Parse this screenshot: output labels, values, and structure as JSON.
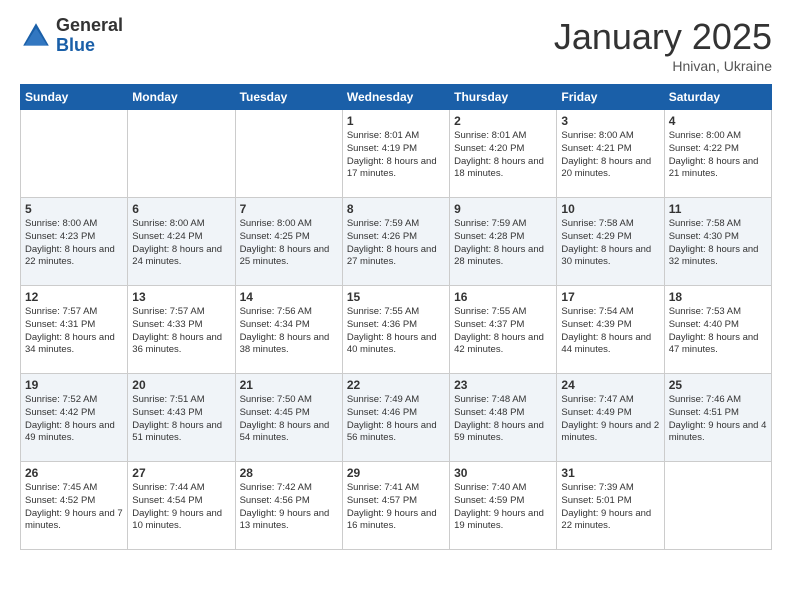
{
  "header": {
    "logo_general": "General",
    "logo_blue": "Blue",
    "month_title": "January 2025",
    "location": "Hnivan, Ukraine"
  },
  "weekdays": [
    "Sunday",
    "Monday",
    "Tuesday",
    "Wednesday",
    "Thursday",
    "Friday",
    "Saturday"
  ],
  "weeks": [
    [
      {
        "day": "",
        "info": ""
      },
      {
        "day": "",
        "info": ""
      },
      {
        "day": "",
        "info": ""
      },
      {
        "day": "1",
        "info": "Sunrise: 8:01 AM\nSunset: 4:19 PM\nDaylight: 8 hours\nand 17 minutes."
      },
      {
        "day": "2",
        "info": "Sunrise: 8:01 AM\nSunset: 4:20 PM\nDaylight: 8 hours\nand 18 minutes."
      },
      {
        "day": "3",
        "info": "Sunrise: 8:00 AM\nSunset: 4:21 PM\nDaylight: 8 hours\nand 20 minutes."
      },
      {
        "day": "4",
        "info": "Sunrise: 8:00 AM\nSunset: 4:22 PM\nDaylight: 8 hours\nand 21 minutes."
      }
    ],
    [
      {
        "day": "5",
        "info": "Sunrise: 8:00 AM\nSunset: 4:23 PM\nDaylight: 8 hours\nand 22 minutes."
      },
      {
        "day": "6",
        "info": "Sunrise: 8:00 AM\nSunset: 4:24 PM\nDaylight: 8 hours\nand 24 minutes."
      },
      {
        "day": "7",
        "info": "Sunrise: 8:00 AM\nSunset: 4:25 PM\nDaylight: 8 hours\nand 25 minutes."
      },
      {
        "day": "8",
        "info": "Sunrise: 7:59 AM\nSunset: 4:26 PM\nDaylight: 8 hours\nand 27 minutes."
      },
      {
        "day": "9",
        "info": "Sunrise: 7:59 AM\nSunset: 4:28 PM\nDaylight: 8 hours\nand 28 minutes."
      },
      {
        "day": "10",
        "info": "Sunrise: 7:58 AM\nSunset: 4:29 PM\nDaylight: 8 hours\nand 30 minutes."
      },
      {
        "day": "11",
        "info": "Sunrise: 7:58 AM\nSunset: 4:30 PM\nDaylight: 8 hours\nand 32 minutes."
      }
    ],
    [
      {
        "day": "12",
        "info": "Sunrise: 7:57 AM\nSunset: 4:31 PM\nDaylight: 8 hours\nand 34 minutes."
      },
      {
        "day": "13",
        "info": "Sunrise: 7:57 AM\nSunset: 4:33 PM\nDaylight: 8 hours\nand 36 minutes."
      },
      {
        "day": "14",
        "info": "Sunrise: 7:56 AM\nSunset: 4:34 PM\nDaylight: 8 hours\nand 38 minutes."
      },
      {
        "day": "15",
        "info": "Sunrise: 7:55 AM\nSunset: 4:36 PM\nDaylight: 8 hours\nand 40 minutes."
      },
      {
        "day": "16",
        "info": "Sunrise: 7:55 AM\nSunset: 4:37 PM\nDaylight: 8 hours\nand 42 minutes."
      },
      {
        "day": "17",
        "info": "Sunrise: 7:54 AM\nSunset: 4:39 PM\nDaylight: 8 hours\nand 44 minutes."
      },
      {
        "day": "18",
        "info": "Sunrise: 7:53 AM\nSunset: 4:40 PM\nDaylight: 8 hours\nand 47 minutes."
      }
    ],
    [
      {
        "day": "19",
        "info": "Sunrise: 7:52 AM\nSunset: 4:42 PM\nDaylight: 8 hours\nand 49 minutes."
      },
      {
        "day": "20",
        "info": "Sunrise: 7:51 AM\nSunset: 4:43 PM\nDaylight: 8 hours\nand 51 minutes."
      },
      {
        "day": "21",
        "info": "Sunrise: 7:50 AM\nSunset: 4:45 PM\nDaylight: 8 hours\nand 54 minutes."
      },
      {
        "day": "22",
        "info": "Sunrise: 7:49 AM\nSunset: 4:46 PM\nDaylight: 8 hours\nand 56 minutes."
      },
      {
        "day": "23",
        "info": "Sunrise: 7:48 AM\nSunset: 4:48 PM\nDaylight: 8 hours\nand 59 minutes."
      },
      {
        "day": "24",
        "info": "Sunrise: 7:47 AM\nSunset: 4:49 PM\nDaylight: 9 hours\nand 2 minutes."
      },
      {
        "day": "25",
        "info": "Sunrise: 7:46 AM\nSunset: 4:51 PM\nDaylight: 9 hours\nand 4 minutes."
      }
    ],
    [
      {
        "day": "26",
        "info": "Sunrise: 7:45 AM\nSunset: 4:52 PM\nDaylight: 9 hours\nand 7 minutes."
      },
      {
        "day": "27",
        "info": "Sunrise: 7:44 AM\nSunset: 4:54 PM\nDaylight: 9 hours\nand 10 minutes."
      },
      {
        "day": "28",
        "info": "Sunrise: 7:42 AM\nSunset: 4:56 PM\nDaylight: 9 hours\nand 13 minutes."
      },
      {
        "day": "29",
        "info": "Sunrise: 7:41 AM\nSunset: 4:57 PM\nDaylight: 9 hours\nand 16 minutes."
      },
      {
        "day": "30",
        "info": "Sunrise: 7:40 AM\nSunset: 4:59 PM\nDaylight: 9 hours\nand 19 minutes."
      },
      {
        "day": "31",
        "info": "Sunrise: 7:39 AM\nSunset: 5:01 PM\nDaylight: 9 hours\nand 22 minutes."
      },
      {
        "day": "",
        "info": ""
      }
    ]
  ]
}
